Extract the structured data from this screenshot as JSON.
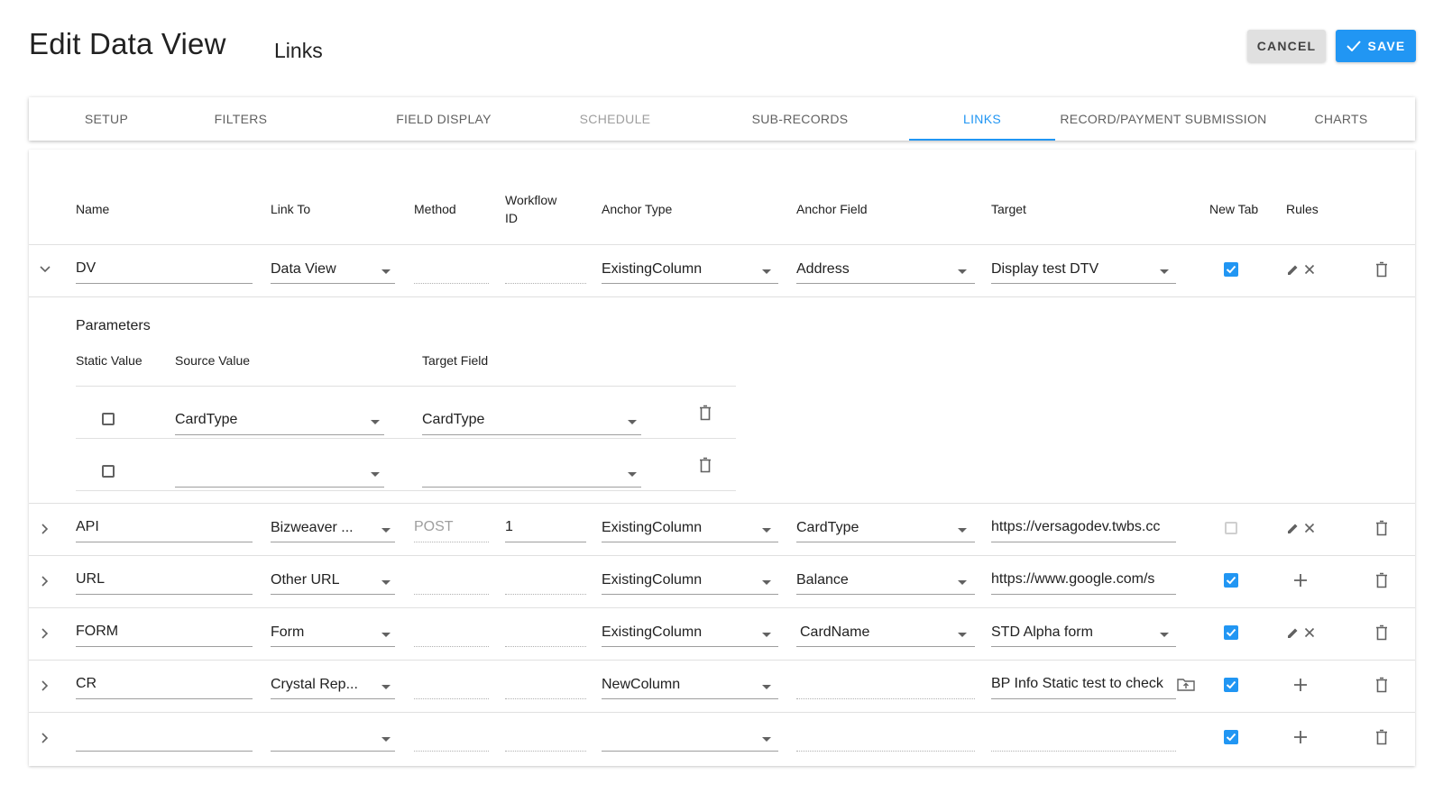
{
  "header": {
    "title": "Edit Data View",
    "subtitle": "Links",
    "cancel_label": "CANCEL",
    "save_label": "SAVE"
  },
  "tabs": [
    {
      "label": "SETUP",
      "state": "normal"
    },
    {
      "label": "FILTERS",
      "state": "normal"
    },
    {
      "label": "FIELD DISPLAY",
      "state": "normal"
    },
    {
      "label": "SCHEDULE",
      "state": "disabled"
    },
    {
      "label": "SUB-RECORDS",
      "state": "normal"
    },
    {
      "label": "LINKS",
      "state": "active"
    },
    {
      "label": "RECORD/PAYMENT SUBMISSION",
      "state": "normal"
    },
    {
      "label": "CHARTS",
      "state": "normal"
    }
  ],
  "columns": {
    "name": "Name",
    "link_to": "Link To",
    "method": "Method",
    "workflow_id": "Workflow ID",
    "anchor_type": "Anchor Type",
    "anchor_field": "Anchor Field",
    "target": "Target",
    "new_tab": "New Tab",
    "rules": "Rules"
  },
  "rows": [
    {
      "name": "DV",
      "link_to": "Data View",
      "method": "",
      "workflow_id": "",
      "anchor_type": "ExistingColumn",
      "anchor_field": "Address",
      "target": "Display test DTV",
      "new_tab": true,
      "rules": "edit-clear",
      "expanded": true
    },
    {
      "name": "API",
      "link_to": "Bizweaver ...",
      "method": "POST",
      "workflow_id": "1",
      "anchor_type": "ExistingColumn",
      "anchor_field": "CardType",
      "target": "https://versagodev.twbs.cc",
      "new_tab": false,
      "rules": "edit-clear",
      "expanded": false
    },
    {
      "name": "URL",
      "link_to": "Other URL",
      "method": "",
      "workflow_id": "",
      "anchor_type": "ExistingColumn",
      "anchor_field": "Balance",
      "target": "https://www.google.com/s",
      "new_tab": true,
      "rules": "add",
      "expanded": false
    },
    {
      "name": "FORM",
      "link_to": "Form",
      "method": "",
      "workflow_id": "",
      "anchor_type": "ExistingColumn",
      "anchor_field": "CardName",
      "target": "STD Alpha form",
      "new_tab": true,
      "rules": "edit-clear",
      "expanded": false
    },
    {
      "name": "CR",
      "link_to": "Crystal Rep...",
      "method": "",
      "workflow_id": "",
      "anchor_type": "NewColumn",
      "anchor_field": "",
      "target": "BP Info Static test to check",
      "new_tab": true,
      "rules": "add",
      "expanded": false
    },
    {
      "name": "",
      "link_to": "",
      "method": "",
      "workflow_id": "",
      "anchor_type": "",
      "anchor_field": "",
      "target": "",
      "new_tab": true,
      "rules": "add",
      "expanded": false
    }
  ],
  "parameters": {
    "title": "Parameters",
    "static_value_header": "Static Value",
    "source_value_header": "Source Value",
    "target_field_header": "Target Field",
    "rows": [
      {
        "static": false,
        "source_value": "CardType",
        "target_field": "CardType"
      },
      {
        "static": false,
        "source_value": "",
        "target_field": ""
      }
    ]
  },
  "colors": {
    "accent": "#2196f3",
    "cancel_bg": "#e0e0e0"
  }
}
